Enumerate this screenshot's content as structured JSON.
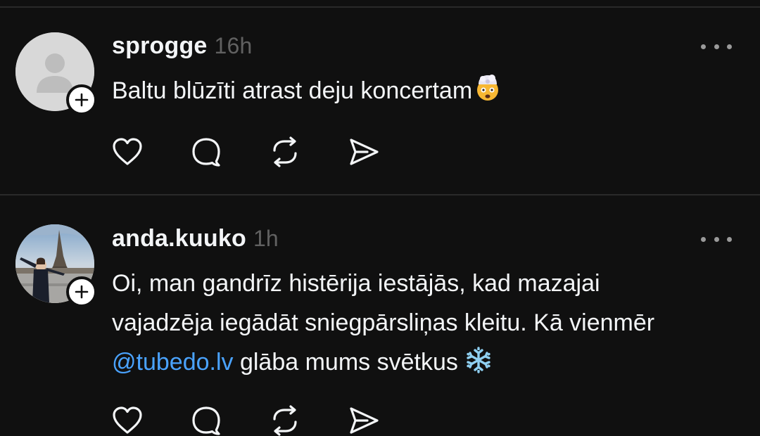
{
  "posts": [
    {
      "username": "sprogge",
      "time": "16h",
      "text": "Baltu blūzīti atrast deju koncertam",
      "emoji": "exploding-head",
      "avatar": "default-avatar"
    },
    {
      "username": "anda.kuuko",
      "time": "1h",
      "text_line1": "Oi, man gandrīz histērija iestājās, kad mazajai",
      "text_line2": "vajadzēja iegādāt sniegpārsliņas kleitu. Kā vienmēr",
      "mention": "@tubedo.lv",
      "text_line3_rest": " glāba mums svētkus",
      "emoji": "snowflake",
      "avatar": "photo-avatar"
    }
  ],
  "icons": {
    "like": "heart-icon",
    "reply": "comment-icon",
    "repost": "repost-icon",
    "share": "send-icon",
    "more": "more-icon",
    "follow": "plus-icon"
  },
  "colors": {
    "background": "#101010",
    "text": "#f3f5f7",
    "muted": "#616161",
    "mention": "#4aa3ff",
    "divider": "#2a2a2a"
  }
}
